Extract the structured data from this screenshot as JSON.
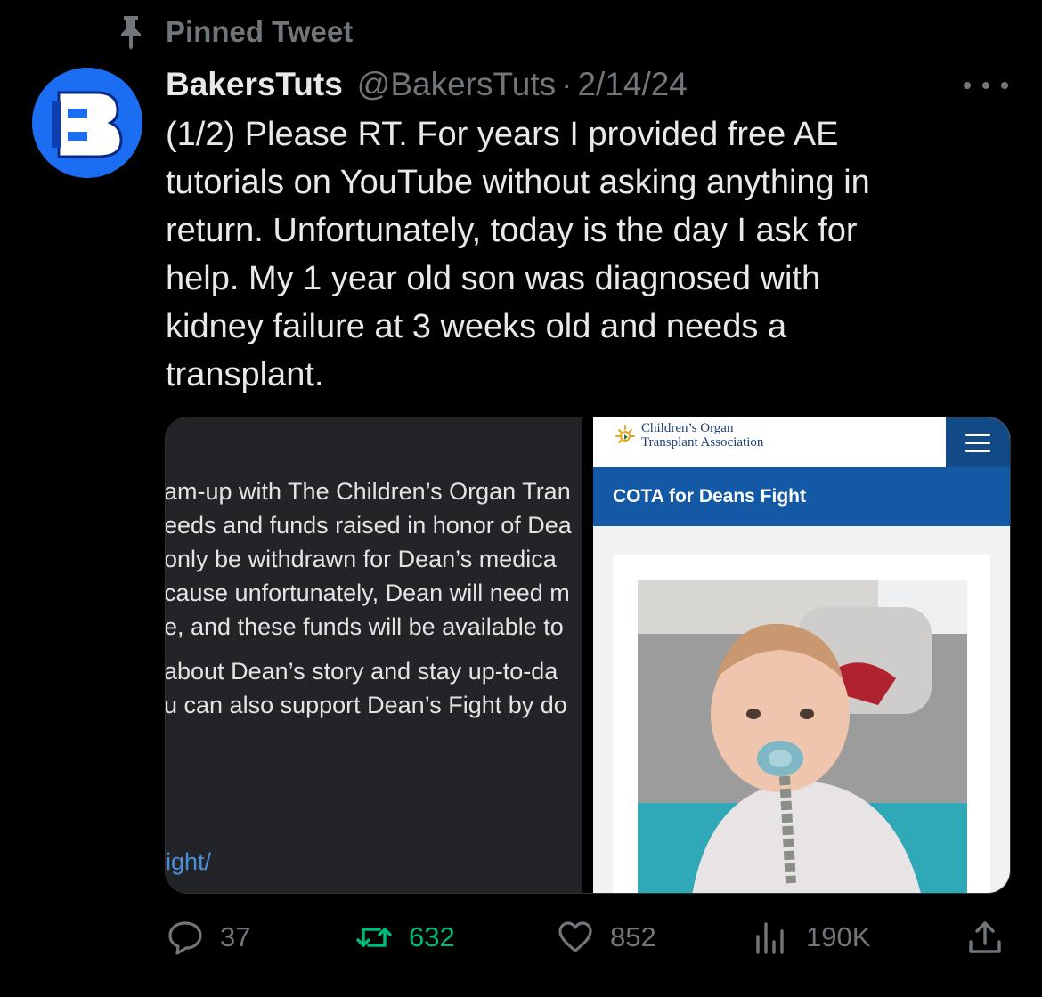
{
  "pinned_label": "Pinned Tweet",
  "tweet": {
    "author": "BakersTuts",
    "handle": "@BakersTuts",
    "separator": "·",
    "date": "2/14/24",
    "text": "(1/2) Please RT. For years I provided free AE\ntutorials on YouTube without asking anything in\nreturn. Unfortunately, today is the day I ask for\nhelp. My 1 year old son was diagnosed with\nkidney failure at 3 weeks old and needs a\ntransplant."
  },
  "media": {
    "left": {
      "lines": [
        "am-up with The Children’s Organ Tran",
        "eeds and funds raised in honor of Dea",
        " only be withdrawn for Dean’s medica",
        "cause unfortunately, Dean will need m",
        "e, and these funds will be available to"
      ],
      "lines2": [
        "about Dean’s story and stay up-to-da",
        "u can also support Dean’s Fight by do"
      ],
      "link": "ight/"
    },
    "right": {
      "logo_line1": "Children’s Organ",
      "logo_line2": "Transplant Association",
      "page_title": "COTA for Deans Fight"
    }
  },
  "actions": {
    "replies": "37",
    "retweets": "632",
    "likes": "852",
    "views": "190K"
  },
  "colors": {
    "background": "#000000",
    "text": "#e7e9ea",
    "muted": "#71767b",
    "retweet_active": "#00ba7c",
    "avatar": "#1b6ef2",
    "cota_blue": "#1459a6"
  }
}
